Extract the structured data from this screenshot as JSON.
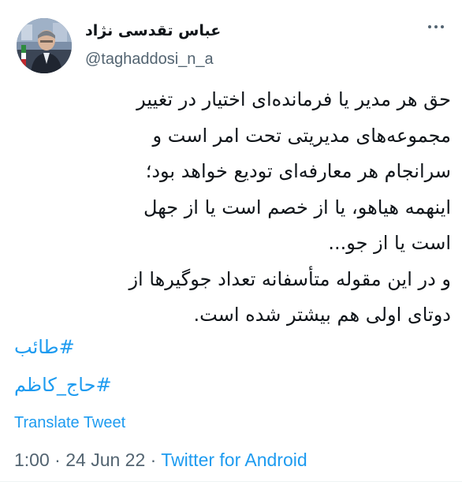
{
  "author": {
    "display_name": "عباس تقدسی نژاد",
    "handle": "@taghaddosi_n_a"
  },
  "tweet": {
    "lines": [
      "حق هر مدیر یا فرمانده‌ای اختیار در تغییر",
      "مجموعه‌های مدیریتی تحت امر است و",
      "سرانجام هر معارفه‌ای تودیع خواهد بود؛",
      "اینهمه هیاهو، یا از خصم است یا از جهل",
      "است یا از جو...",
      "و در این مقوله متأسفانه تعداد جوگیرها از",
      "دوتای اولی هم بیشتر شده است."
    ],
    "hashtags": [
      "#طائب",
      "#حاج_کاظم"
    ],
    "translate_label": "Translate Tweet"
  },
  "meta": {
    "time": "1:00",
    "separator": "·",
    "date": "24 Jun 22",
    "source": "Twitter for Android"
  },
  "icons": {
    "more": "more-dots-icon",
    "avatar": "profile-photo"
  },
  "colors": {
    "text": "#0f1419",
    "secondary": "#536471",
    "link": "#1d9bf0"
  }
}
